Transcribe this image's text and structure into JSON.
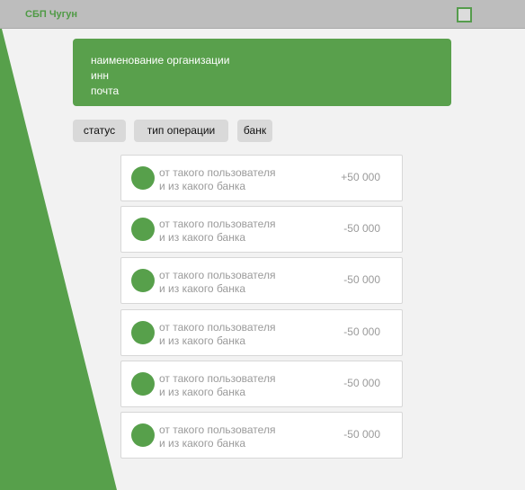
{
  "header": {
    "title": "СБП Чугун"
  },
  "organization": {
    "name": "наименование организации",
    "inn": "инн",
    "email": "почта"
  },
  "filters": [
    "статус",
    "тип операции",
    "банк"
  ],
  "transactions": [
    {
      "line1": "от такого пользователя",
      "line2": "и из какого банка",
      "amount": "+50 000"
    },
    {
      "line1": "от такого пользователя",
      "line2": "и из какого банка",
      "amount": "-50 000"
    },
    {
      "line1": "от такого пользователя",
      "line2": "и из какого банка",
      "amount": "-50 000"
    },
    {
      "line1": "от такого пользователя",
      "line2": "и из какого банка",
      "amount": "-50 000"
    },
    {
      "line1": "от такого пользователя",
      "line2": "и из какого банка",
      "amount": "-50 000"
    },
    {
      "line1": "от такого пользователя",
      "line2": "и из какого банка",
      "amount": "-50 000"
    }
  ],
  "colors": {
    "accent_green": "#57a04b",
    "header_bg": "#bdbdbd",
    "page_bg": "#f2f2f2",
    "filter_bg": "#d9d9d9"
  }
}
